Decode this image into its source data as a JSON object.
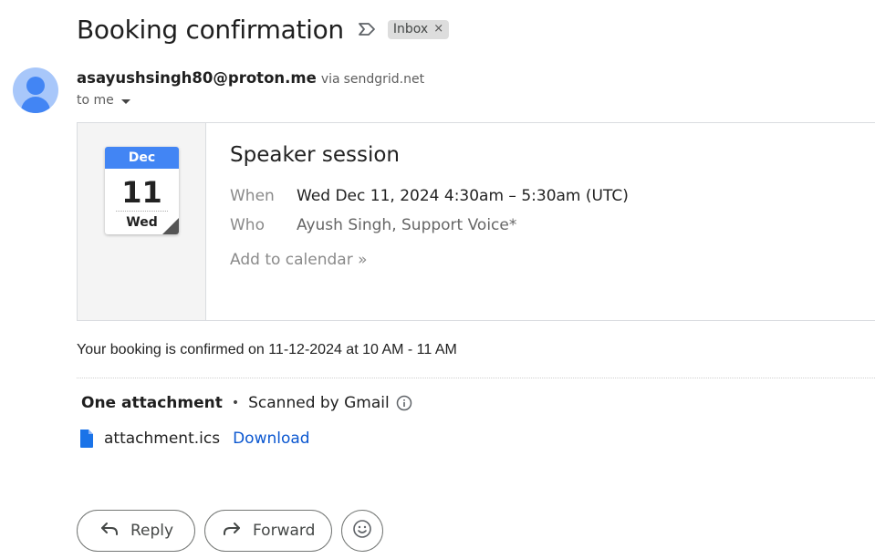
{
  "email": {
    "subject": "Booking confirmation",
    "label": "Inbox",
    "label_close": "×",
    "sender_email": "asayushsingh80@proton.me",
    "via_text": "via",
    "via_domain": "sendgrid.net",
    "recipient": "to me"
  },
  "invite": {
    "calendar_month": "Dec",
    "calendar_day": "11",
    "calendar_weekday": "Wed",
    "event_title": "Speaker session",
    "when_label": "When",
    "when_value": "Wed Dec 11, 2024 4:30am – 5:30am (UTC)",
    "who_label": "Who",
    "who_value": "Ayush Singh, Support Voice*",
    "add_to_calendar": "Add to calendar »"
  },
  "body_text": "Your booking is confirmed on 11-12-2024 at 10 AM - 11 AM",
  "attachments": {
    "count_label": "One attachment",
    "separator": "•",
    "scanned_label": "Scanned by Gmail",
    "file_name": "attachment.ics",
    "download_label": "Download"
  },
  "actions": {
    "reply_label": "Reply",
    "forward_label": "Forward"
  },
  "colors": {
    "accent_blue": "#0b57d0",
    "calendar_blue": "#4285f4",
    "avatar_bg": "#a8c7fa",
    "label_bg": "#dddddd"
  },
  "icons": {
    "important": "label-arrow-icon",
    "avatar": "person-avatar-icon",
    "caret": "caret-down-icon",
    "info": "info-icon",
    "file": "document-icon",
    "reply": "reply-arrow-icon",
    "forward": "forward-arrow-icon",
    "emoji": "smiley-icon"
  }
}
